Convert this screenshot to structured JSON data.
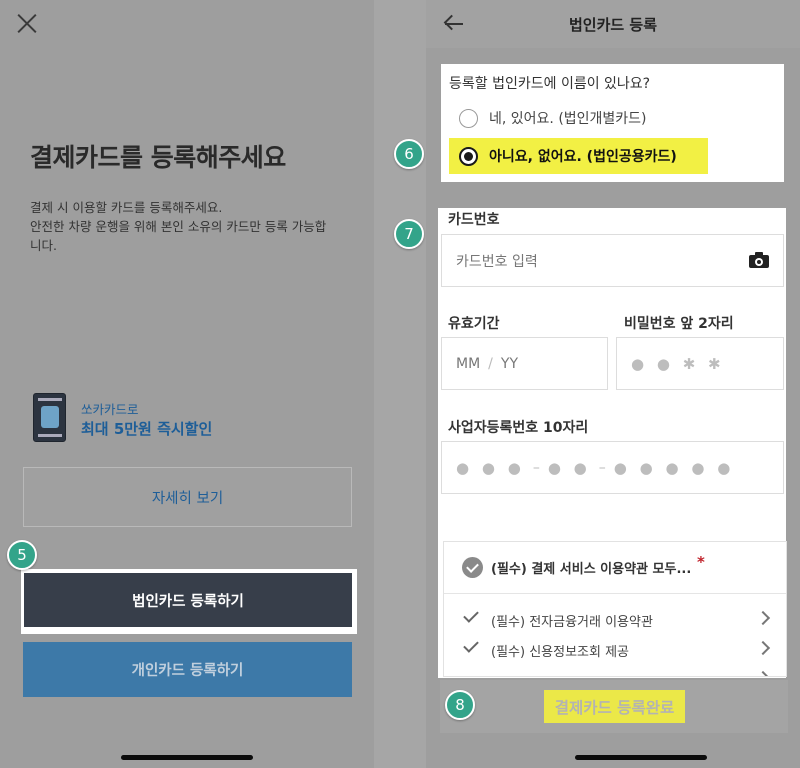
{
  "left": {
    "title": "결제카드를 등록해주세요",
    "description_line1": "결제 시 이용할 카드를 등록해주세요.",
    "description_line2": "안전한 차량 운행을 위해 본인 소유의 카드만 등록 가능합",
    "description_line3": "니다.",
    "promo_small": "쏘카카드로",
    "promo_big": "최대 5만원 즉시할인",
    "detail_button": "자세히 보기",
    "corporate_button": "법인카드 등록하기",
    "personal_button": "개인카드 등록하기",
    "step_badge": "5"
  },
  "right": {
    "header_title": "법인카드 등록",
    "question": "등록할 법인카드에 이름이 있나요?",
    "option_yes": "네, 있어요. (법인개별카드)",
    "option_no": "아니요, 없어요. (법인공용카드)",
    "card_number_label": "카드번호",
    "card_number_placeholder": "카드번호 입력",
    "expiry_label": "유효기간",
    "expiry_mm": "MM",
    "expiry_slash": "/",
    "expiry_yy": "YY",
    "password_label": "비밀번호 앞 2자리",
    "password_dots": "● ● ✱ ✱",
    "business_label": "사업자등록번호 10자리",
    "business_dots_1": "● ● ●",
    "business_dots_2": "● ●",
    "business_dots_3": "● ● ● ● ●",
    "business_dash": "–",
    "terms_all": "(필수) 결제 서비스 이용약관 모두...",
    "required_star": "*",
    "term_1": "(필수) 전자금융거래 이용약관",
    "term_2": "(필수) 신용정보조회 제공",
    "submit_button": "결제카드 등록완료",
    "step_badges": [
      "6",
      "7",
      "8"
    ]
  },
  "colors": {
    "highlight_yellow": "#f2f044",
    "badge_green": "#33a48a",
    "corporate_button_bg": "#373e4a",
    "personal_button_bg": "#3d79a8",
    "link_blue": "#1e5e98"
  },
  "selected_option": "option_no"
}
